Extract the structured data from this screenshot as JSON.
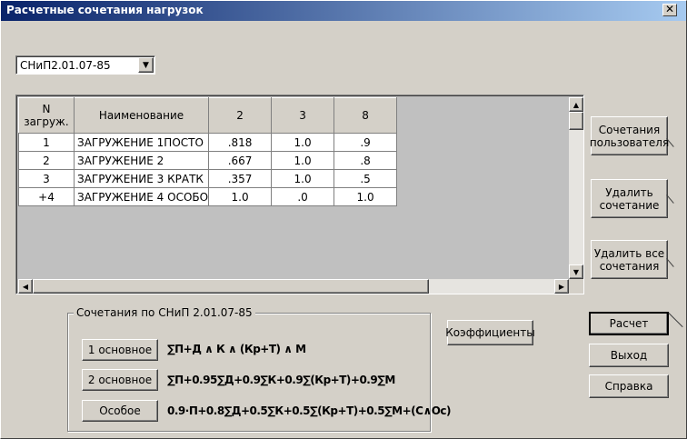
{
  "window": {
    "title": "Расчетные сочетания нагрузок",
    "close_glyph": "✕"
  },
  "norm_select": {
    "value": "СНиП2.01.07-85",
    "arrow": "▼"
  },
  "grid": {
    "columns": [
      "N загруж.",
      "Наименование",
      "2",
      "3",
      "8"
    ],
    "rows": [
      [
        "1",
        "ЗАГРУЖЕНИЕ 1ПОСТО",
        ".818",
        "1.0",
        ".9"
      ],
      [
        "2",
        "ЗАГРУЖЕНИЕ 2",
        ".667",
        "1.0",
        ".8"
      ],
      [
        "3",
        "ЗАГРУЖЕНИЕ 3 КРАТК",
        ".357",
        "1.0",
        ".5"
      ],
      [
        "+4",
        "ЗАГРУЖЕНИЕ 4 ОСОБО",
        "1.0",
        ".0",
        "1.0"
      ]
    ]
  },
  "side_buttons": {
    "user_combos": "Сочетания пользователя",
    "delete_combo": "Удалить сочетание",
    "delete_all": "Удалить все сочетания",
    "coefficients": "Коэффициенты",
    "calculate": "Расчет",
    "exit": "Выход",
    "help": "Справка"
  },
  "snip_group": {
    "label": "Сочетания по СНиП 2.01.07-85",
    "items": [
      {
        "button": "1 основное",
        "formula": "∑П+Д ∧ К ∧ (Кр+Т) ∧ М"
      },
      {
        "button": "2 основное",
        "formula": "∑П+0.95∑Д+0.9∑К+0.9∑(Кр+Т)+0.9∑М"
      },
      {
        "button": "Особое",
        "formula": "0.9·П+0.8∑Д+0.5∑К+0.5∑(Кр+Т)+0.5∑М+(С∧Ос)"
      }
    ]
  },
  "icons": {
    "scroll_up": "▲",
    "scroll_down": "▼",
    "scroll_left": "◀",
    "scroll_right": "▶"
  }
}
